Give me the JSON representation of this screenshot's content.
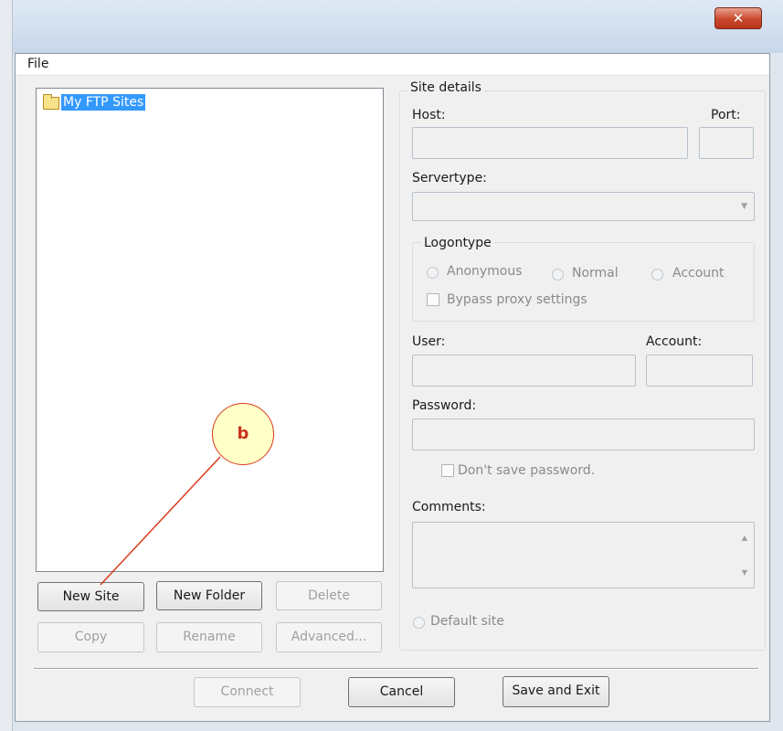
{
  "menu": {
    "file": "File"
  },
  "tree": {
    "root_label": "My FTP Sites"
  },
  "buttons": {
    "new_site": "New Site",
    "new_folder": "New Folder",
    "delete": "Delete",
    "copy": "Copy",
    "rename": "Rename",
    "advanced": "Advanced...",
    "connect": "Connect",
    "cancel": "Cancel",
    "save_exit": "Save and Exit"
  },
  "site_details": {
    "legend": "Site details",
    "host_label": "Host:",
    "port_label": "Port:",
    "servertype_label": "Servertype:",
    "logontype": {
      "legend": "Logontype",
      "anonymous": "Anonymous",
      "normal": "Normal",
      "account": "Account",
      "bypass_proxy": "Bypass proxy settings"
    },
    "user_label": "User:",
    "account_label": "Account:",
    "password_label": "Password:",
    "dont_save_password": "Don't save password.",
    "comments_label": "Comments:",
    "default_site": "Default site"
  },
  "annotation": {
    "label": "b"
  },
  "colors": {
    "selection": "#3399ff",
    "annotation": "#d93a1a",
    "close_button": "#c9472b"
  }
}
